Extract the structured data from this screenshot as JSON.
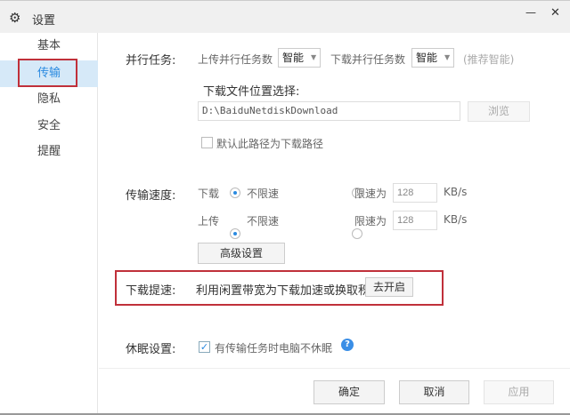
{
  "window": {
    "title": "设置",
    "minimize": "—",
    "close": "✕"
  },
  "sidebar": {
    "items": [
      {
        "label": "基本"
      },
      {
        "label": "传输"
      },
      {
        "label": "隐私"
      },
      {
        "label": "安全"
      },
      {
        "label": "提醒"
      }
    ]
  },
  "parallel": {
    "label": "并行任务:",
    "upload_label": "上传并行任务数",
    "upload_value": "智能",
    "download_label": "下载并行任务数",
    "download_value": "智能",
    "hint": "(推荐智能)"
  },
  "location": {
    "label": "下载文件位置选择:",
    "path": "D:\\BaiduNetdiskDownload",
    "browse": "浏览",
    "default_checkbox": "默认此路径为下载路径"
  },
  "speed": {
    "label": "传输速度:",
    "rows": [
      {
        "dir": "下载",
        "unlimited": "不限速",
        "limit": "限速为",
        "value": "128",
        "unit": "KB/s"
      },
      {
        "dir": "上传",
        "unlimited": "不限速",
        "limit": "限速为",
        "value": "128",
        "unit": "KB/s"
      }
    ],
    "advanced": "高级设置"
  },
  "boost": {
    "label": "下载提速:",
    "text": "利用闲置带宽为下载加速或换取积分",
    "button": "去开启"
  },
  "sleep": {
    "label": "休眠设置:",
    "checkbox": "有传输任务时电脑不休眠",
    "checked": true
  },
  "footer": {
    "ok": "确定",
    "cancel": "取消",
    "apply": "应用"
  },
  "colors": {
    "accent": "#2a8ae0",
    "highlight": "#c0303a"
  }
}
